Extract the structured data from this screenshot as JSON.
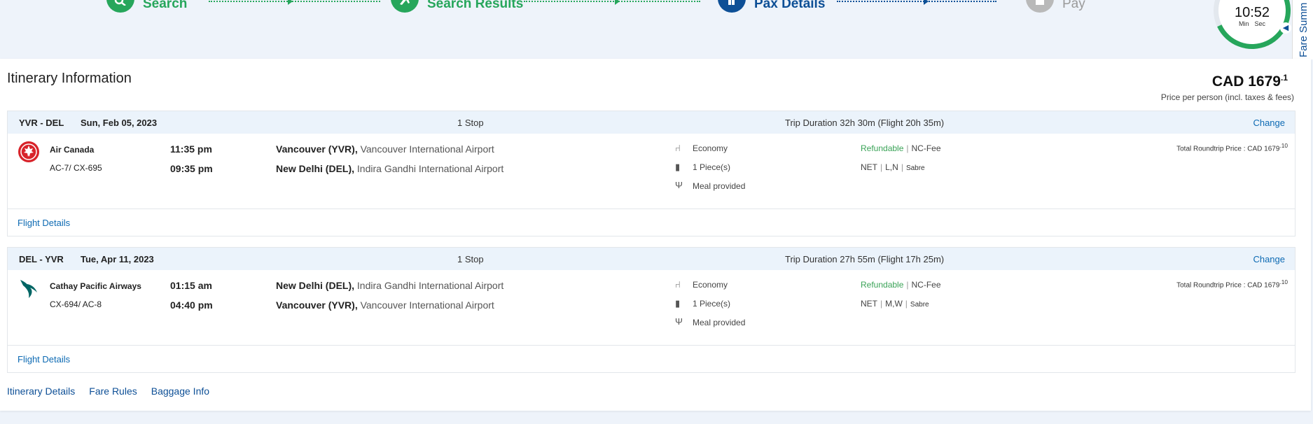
{
  "stepper": {
    "steps": [
      {
        "label": "Search",
        "state": "done"
      },
      {
        "label": "Search Results",
        "state": "done"
      },
      {
        "label": "Pax Details",
        "state": "current"
      },
      {
        "label": "Pay",
        "state": "pending"
      }
    ]
  },
  "timer": {
    "time": "10:52",
    "min_label": "Min",
    "sec_label": "Sec"
  },
  "fare_summary_tab": "Fare Summ",
  "itinerary": {
    "title": "Itinerary Information",
    "price": "CAD 1679",
    "price_decimals": ".1",
    "price_note": "Price per person (incl. taxes & fees)"
  },
  "legs": [
    {
      "route": "YVR - DEL",
      "date": "Sun, Feb 05, 2023",
      "stops": "1 Stop",
      "duration": "Trip Duration 32h 30m (Flight 20h 35m)",
      "change": "Change",
      "airline": "Air Canada",
      "flight_no": "AC-7/ CX-695",
      "dep_time": "11:35 pm",
      "arr_time": "09:35 pm",
      "dep_code": "Vancouver (YVR),",
      "dep_airport": " Vancouver International Airport",
      "arr_code": "New Delhi (DEL),",
      "arr_airport": " Indira Gandhi International Airport",
      "cabin": "Economy",
      "baggage": "1 Piece(s)",
      "meal": "Meal provided",
      "refundable": "Refundable",
      "fee": "NC-Fee",
      "fare_type": "NET",
      "fare_class": "L,N",
      "gds": "Sabre",
      "total_label": "Total Roundtrip Price : CAD 1679",
      "total_decimals": ".10",
      "flight_details": "Flight Details"
    },
    {
      "route": "DEL - YVR",
      "date": "Tue, Apr 11, 2023",
      "stops": "1 Stop",
      "duration": "Trip Duration 27h 55m (Flight 17h 25m)",
      "change": "Change",
      "airline": "Cathay Pacific Airways",
      "flight_no": "CX-694/ AC-8",
      "dep_time": "01:15 am",
      "arr_time": "04:40 pm",
      "dep_code": "New Delhi (DEL),",
      "dep_airport": " Indira Gandhi International Airport",
      "arr_code": "Vancouver (YVR),",
      "arr_airport": " Vancouver International Airport",
      "cabin": "Economy",
      "baggage": "1 Piece(s)",
      "meal": "Meal provided",
      "refundable": "Refundable",
      "fee": "NC-Fee",
      "fare_type": "NET",
      "fare_class": "M,W",
      "gds": "Sabre",
      "total_label": "Total Roundtrip Price : CAD 1679",
      "total_decimals": ".10",
      "flight_details": "Flight Details"
    }
  ],
  "bottom_tabs": [
    "Itinerary Details",
    "Fare Rules",
    "Baggage Info"
  ],
  "colors": {
    "green": "#26a65b",
    "blue": "#0d4f96",
    "link": "#0d6ab3",
    "air_canada_red": "#d8232a",
    "cathay_green": "#006564"
  }
}
